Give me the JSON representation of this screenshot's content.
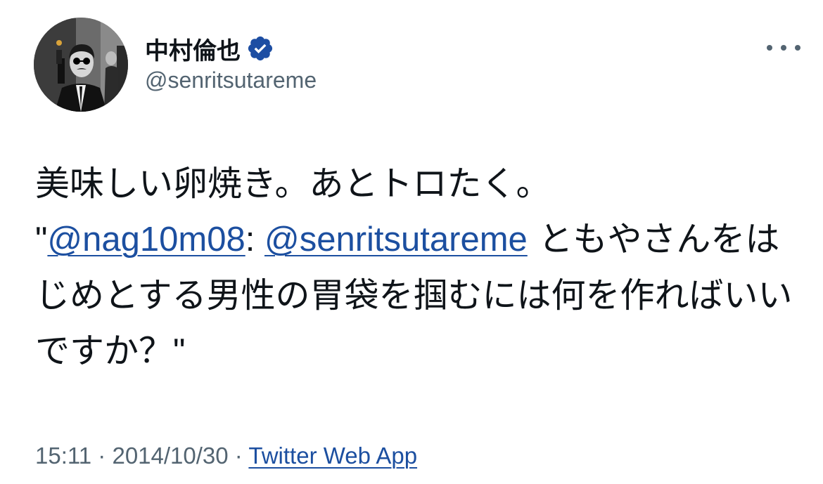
{
  "author": {
    "display_name": "中村倫也",
    "handle": "@senritsutareme",
    "verified": true
  },
  "tweet": {
    "line1": "美味しい卵焼き。あとトロたく。",
    "quote_open": "\"",
    "mention1": "@nag10m08",
    "colon": ": ",
    "mention2": "@senritsutareme",
    "text_after_mention": " ともやさんをはじめとする男性の胃袋を掴むには何を作ればいいですか？",
    "quote_close": "\""
  },
  "meta": {
    "time": "15:11",
    "separator1": " · ",
    "date": "2014/10/30",
    "separator2": " · ",
    "source": "Twitter Web App"
  },
  "colors": {
    "link": "#1c4fa0",
    "verified_badge": "#1d4ea3",
    "secondary_text": "#536471",
    "primary_text": "#0f1419"
  },
  "icons": {
    "verified": "verified-badge-icon",
    "more": "more-dots-icon"
  }
}
